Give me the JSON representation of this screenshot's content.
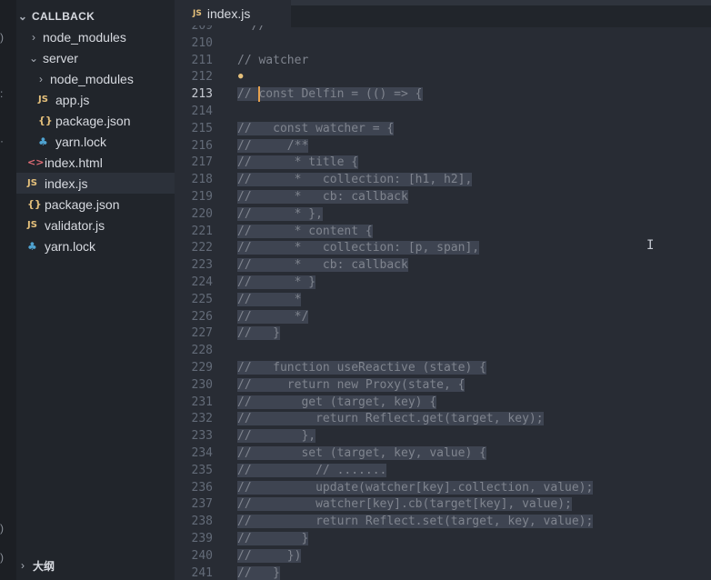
{
  "explorer": {
    "root_label": "CALLBACK",
    "items": [
      {
        "label": "node_modules",
        "icon": "chevron-right-icon",
        "kind": "folder"
      },
      {
        "label": "server",
        "icon": "chevron-down-icon",
        "kind": "folder"
      },
      {
        "label": "node_modules",
        "icon": "chevron-right-icon",
        "kind": "folder"
      },
      {
        "label": "app.js",
        "icon": "js-file-icon",
        "badge": "JS"
      },
      {
        "label": "package.json",
        "icon": "json-file-icon",
        "badge": "{}"
      },
      {
        "label": "yarn.lock",
        "icon": "yarn-file-icon",
        "badge": "♣"
      },
      {
        "label": "index.html",
        "icon": "html-file-icon",
        "badge": "<>"
      },
      {
        "label": "index.js",
        "icon": "js-file-icon",
        "badge": "JS",
        "selected": true
      },
      {
        "label": "package.json",
        "icon": "json-file-icon",
        "badge": "{}"
      },
      {
        "label": "validator.js",
        "icon": "js-file-icon",
        "badge": "JS"
      },
      {
        "label": "yarn.lock",
        "icon": "yarn-file-icon",
        "badge": "♣"
      }
    ]
  },
  "outline": {
    "label": "大纲"
  },
  "tab": {
    "label": "index.js",
    "badge": "JS"
  },
  "editor": {
    "active_line": 213,
    "lines": [
      {
        "n": "209",
        "text": "  //"
      },
      {
        "n": "210",
        "text": ""
      },
      {
        "n": "211",
        "text": "// watcher"
      },
      {
        "n": "212",
        "text": ""
      },
      {
        "n": "213",
        "text": "// const Delfin = (() => {"
      },
      {
        "n": "214",
        "text": ""
      },
      {
        "n": "215",
        "text": "//   const watcher = {"
      },
      {
        "n": "216",
        "text": "//     /**"
      },
      {
        "n": "217",
        "text": "//      * title {"
      },
      {
        "n": "218",
        "text": "//      *   collection: [h1, h2],"
      },
      {
        "n": "219",
        "text": "//      *   cb: callback"
      },
      {
        "n": "220",
        "text": "//      * },"
      },
      {
        "n": "221",
        "text": "//      * content {"
      },
      {
        "n": "222",
        "text": "//      *   collection: [p, span],"
      },
      {
        "n": "223",
        "text": "//      *   cb: callback"
      },
      {
        "n": "224",
        "text": "//      * }"
      },
      {
        "n": "225",
        "text": "//      *"
      },
      {
        "n": "226",
        "text": "//      */"
      },
      {
        "n": "227",
        "text": "//   }"
      },
      {
        "n": "228",
        "text": ""
      },
      {
        "n": "229",
        "text": "//   function useReactive (state) {"
      },
      {
        "n": "230",
        "text": "//     return new Proxy(state, {"
      },
      {
        "n": "231",
        "text": "//       get (target, key) {"
      },
      {
        "n": "232",
        "text": "//         return Reflect.get(target, key);"
      },
      {
        "n": "233",
        "text": "//       },"
      },
      {
        "n": "234",
        "text": "//       set (target, key, value) {"
      },
      {
        "n": "235",
        "text": "//         // ......."
      },
      {
        "n": "236",
        "text": "//         update(watcher[key].collection, value);"
      },
      {
        "n": "237",
        "text": "//         watcher[key].cb(target[key], value);"
      },
      {
        "n": "238",
        "text": "//         return Reflect.set(target, key, value);"
      },
      {
        "n": "239",
        "text": "//       }"
      },
      {
        "n": "240",
        "text": "//     })"
      },
      {
        "n": "241",
        "text": "//   }"
      }
    ]
  },
  "colors": {
    "editor_bg": "#282c34",
    "sidebar_bg": "#21252b",
    "selection": "#3e4451",
    "comment": "#7f848e",
    "line_number": "#636b78",
    "js_badge": "#e5c07b",
    "html_badge": "#e06c75",
    "yarn_badge": "#4fa3d1"
  }
}
